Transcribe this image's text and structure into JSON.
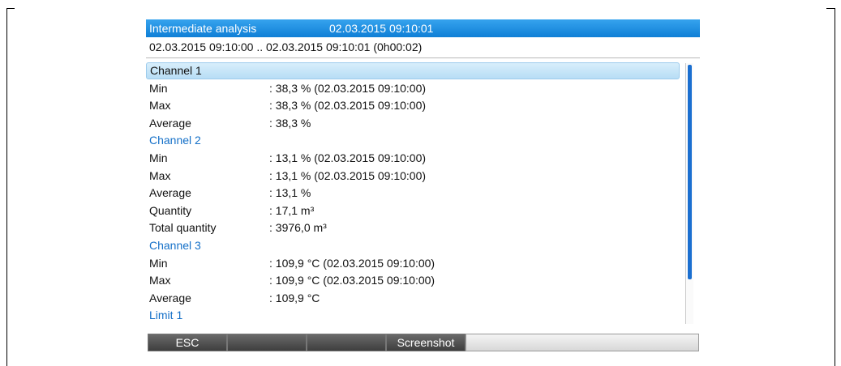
{
  "header": {
    "title": "Intermediate analysis",
    "timestamp": "02.03.2015 09:10:01"
  },
  "range": "02.03.2015 09:10:00 .. 02.03.2015 09:10:01 (0h00:02)",
  "rows": [
    {
      "label": "Channel 1",
      "value": "",
      "type": "section-selected"
    },
    {
      "label": "Min",
      "value": ": 38,3 % (02.03.2015 09:10:00)",
      "type": "item"
    },
    {
      "label": "Max",
      "value": ": 38,3 % (02.03.2015 09:10:00)",
      "type": "item"
    },
    {
      "label": "Average",
      "value": ": 38,3 %",
      "type": "item"
    },
    {
      "label": "Channel 2",
      "value": "",
      "type": "section"
    },
    {
      "label": "Min",
      "value": ": 13,1 % (02.03.2015 09:10:00)",
      "type": "item"
    },
    {
      "label": "Max",
      "value": ": 13,1 % (02.03.2015 09:10:00)",
      "type": "item"
    },
    {
      "label": "Average",
      "value": ": 13,1 %",
      "type": "item"
    },
    {
      "label": "Quantity",
      "value": ": 17,1 m³",
      "type": "item"
    },
    {
      "label": "Total quantity",
      "value": ": 3976,0 m³",
      "type": "item"
    },
    {
      "label": "Channel 3",
      "value": "",
      "type": "section"
    },
    {
      "label": "Min",
      "value": ": 109,9 °C (02.03.2015 09:10:00)",
      "type": "item"
    },
    {
      "label": "Max",
      "value": ": 109,9 °C (02.03.2015 09:10:00)",
      "type": "item"
    },
    {
      "label": "Average",
      "value": ": 109,9 °C",
      "type": "item"
    },
    {
      "label": "Limit 1",
      "value": "",
      "type": "section"
    }
  ],
  "softkeys": [
    {
      "label": "ESC"
    },
    {
      "label": ""
    },
    {
      "label": ""
    },
    {
      "label": "Screenshot"
    },
    {
      "label": ""
    }
  ],
  "colors": {
    "title_bar": "#1a8ae0",
    "section_text": "#1570c8",
    "scroll_thumb": "#1b6fd0",
    "softkey_dark": "#4a4a4a"
  }
}
